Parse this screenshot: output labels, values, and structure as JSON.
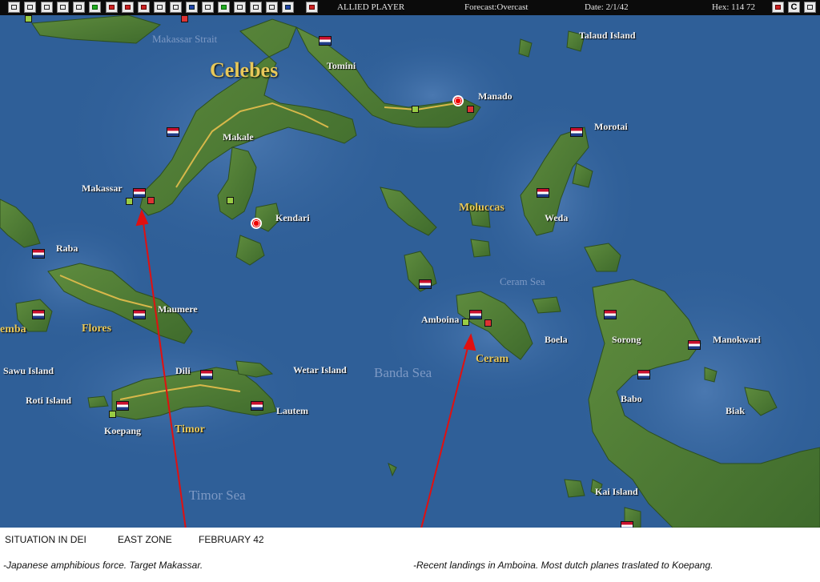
{
  "toolbar": {
    "player": "ALLIED PLAYER",
    "forecast": "Forecast:Overcast",
    "date": "Date: 2/1/42",
    "hex": "Hex: 114 72",
    "right_btn_label": "C"
  },
  "places": {
    "makassar_strait": "Makassar Strait",
    "celebes": "Celebes",
    "tomini": "Tomini",
    "talaud": "Talaud Island",
    "manado": "Manado",
    "morotai": "Morotai",
    "makale": "Makale",
    "makassar": "Makassar",
    "kendari": "Kendari",
    "moluccas": "Moluccas",
    "weda": "Weda",
    "raba": "Raba",
    "ceram_sea": "Ceram Sea",
    "maumere": "Maumere",
    "amboina": "Amboina",
    "sorong": "Sorong",
    "manokwari": "Manokwari",
    "sumba": "embа",
    "flores": "Flores",
    "boela": "Boela",
    "ceram": "Ceram",
    "sawu": "Sawu Island",
    "dili": "Dili",
    "wetar": "Wetar Island",
    "banda_sea": "Banda Sea",
    "babo": "Babo",
    "roti": "Roti Island",
    "lautem": "Lautem",
    "biak": "Biak",
    "koepang": "Koepang",
    "timor": "Timor",
    "timor_sea": "Timor Sea",
    "kai": "Kai Island"
  },
  "caption": {
    "title": "SITUATION IN DEI",
    "zone": "EAST ZONE",
    "month": "FEBRUARY 42",
    "note_left": "-Japanese amphibious force. Target Makassar.",
    "note_right": "-Recent landings in Amboina. Most dutch planes traslated to Koepang."
  },
  "colors": {
    "sea": "#2f5f98",
    "land": "#4f7d34",
    "arrow": "#e01010",
    "region_label": "#e8c85a"
  }
}
